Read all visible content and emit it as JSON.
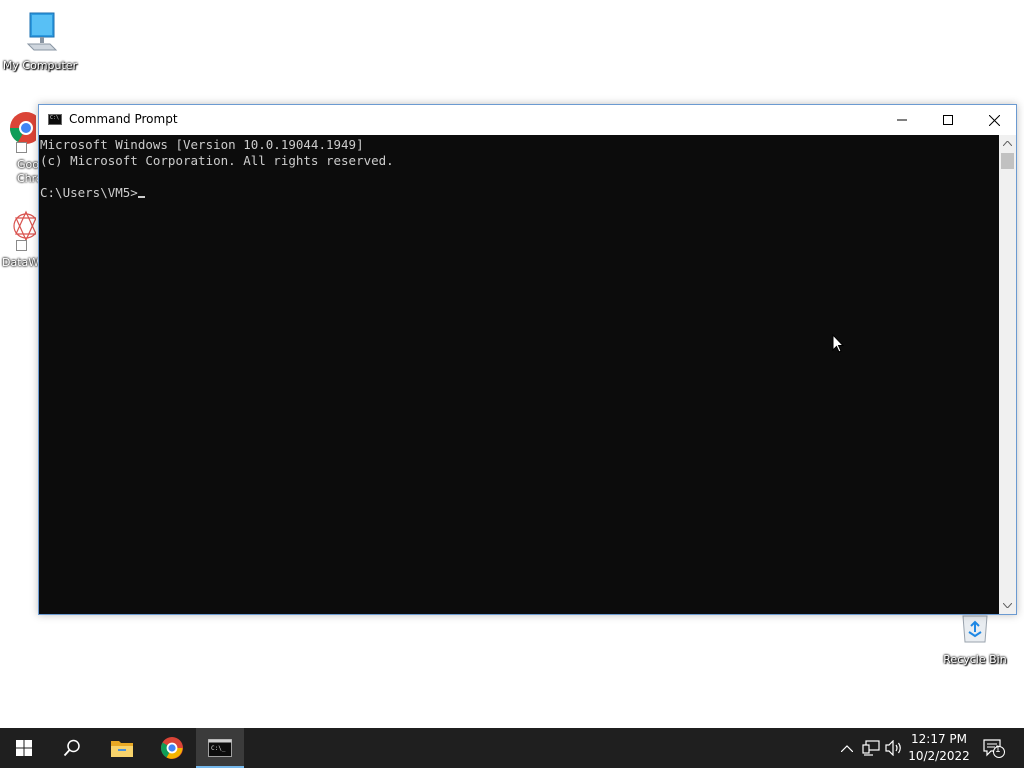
{
  "desktop": {
    "icons": [
      {
        "label": "My Computer"
      },
      {
        "label": "Goo\nChro"
      },
      {
        "label": "DataW"
      },
      {
        "label": "Recycle Bin"
      }
    ]
  },
  "window": {
    "title": "Command Prompt",
    "console_lines": [
      "Microsoft Windows [Version 10.0.19044.1949]",
      "(c) Microsoft Corporation. All rights reserved.",
      "",
      "C:\\Users\\VM5>"
    ]
  },
  "taskbar": {
    "pinned": [
      "start-icon",
      "search-icon",
      "file-explorer-icon",
      "chrome-icon",
      "command-prompt-icon"
    ],
    "clock_time": "12:17 PM",
    "clock_date": "10/2/2022",
    "notification_count": "1"
  },
  "colors": {
    "console_bg": "#0c0c0c",
    "console_text": "#cccccc",
    "taskbar_bg": "#1f1f1f",
    "accent": "#76b9ed"
  }
}
